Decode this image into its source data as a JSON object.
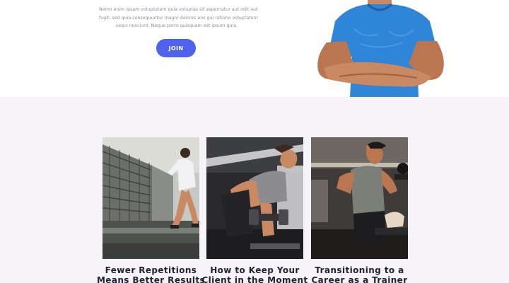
{
  "hero": {
    "paragraph_lines": [
      "Nemo enim ipsam voluptatem quia voluptas sit aspernatur aut odit aut",
      "fugit, sed quia consequuntur magni dolores eos qui ratione voluptatem",
      "sequi nesciunt. Neque porro quisquam est ipsum quia."
    ],
    "join_label": "JOIN",
    "accent_color": "#4f62ee",
    "shirt_color": "#2f86d8"
  },
  "articles": [
    {
      "title_line1": "Fewer Repetitions",
      "title_line2": "Means Better Results"
    },
    {
      "title_line1": "How to Keep Your",
      "title_line2": "Client in the Moment"
    },
    {
      "title_line1": "Transitioning to a",
      "title_line2": "Career as a Trainer"
    }
  ],
  "colors": {
    "section_bg": "#f6f4f8",
    "title_color": "#222230"
  }
}
